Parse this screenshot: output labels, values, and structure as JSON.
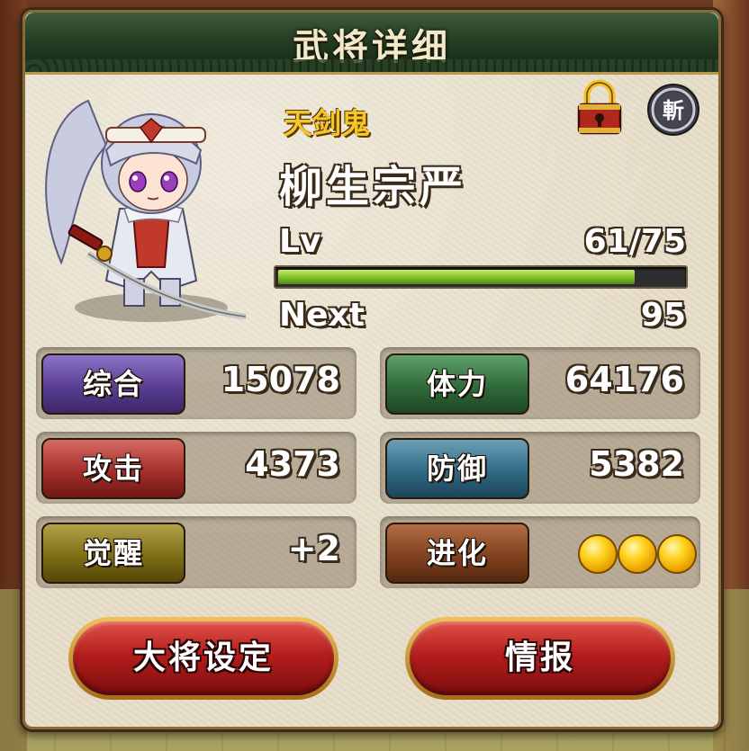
{
  "title": "武将详细",
  "character": {
    "rarity_name": "天剑鬼",
    "name": "柳生宗严",
    "level_label": "Lv",
    "level_value": "61/75",
    "exp_fraction": 0.88,
    "next_label": "Next",
    "next_value": "95"
  },
  "icons": {
    "lock": "lock-icon",
    "zan": "斬"
  },
  "stats": {
    "total": {
      "label": "综合",
      "value": "15078"
    },
    "stamina": {
      "label": "体力",
      "value": "64176"
    },
    "attack": {
      "label": "攻击",
      "value": "4373"
    },
    "defense": {
      "label": "防御",
      "value": "5382"
    },
    "awaken": {
      "label": "觉醒",
      "value": "+2"
    },
    "evolve": {
      "label": "进化",
      "coins": 3
    }
  },
  "buttons": {
    "leader": "大将设定",
    "info": "情报"
  },
  "colors": {
    "accent_gold": "#f6c52a",
    "exp_green": "#83c22d",
    "button_red": "#b41e1c"
  }
}
